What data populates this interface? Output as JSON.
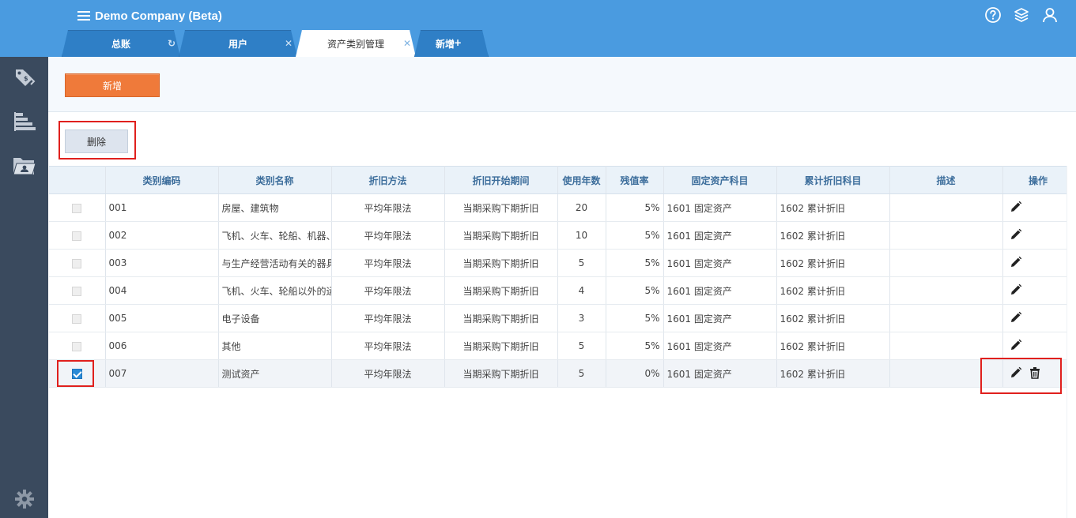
{
  "app": {
    "title": "Demo Company (Beta)"
  },
  "header_icons": [
    "help-icon",
    "layers-icon",
    "user-icon"
  ],
  "tabs": [
    {
      "label": "总账",
      "icon": "refresh-icon",
      "active": false
    },
    {
      "label": "用户",
      "icon": "close-icon",
      "active": false
    },
    {
      "label": "资产类别管理",
      "icon": "close-icon",
      "active": true
    },
    {
      "label": "新增",
      "icon": "plus-icon",
      "active": false
    }
  ],
  "sidebar": {
    "items": [
      "tags-icon",
      "bar-chart-icon",
      "folder-icon",
      "gear-icon"
    ]
  },
  "toolbar": {
    "add_label": "新增",
    "delete_label": "删除"
  },
  "table": {
    "columns": [
      "类别编码",
      "类别名称",
      "折旧方法",
      "折旧开始期间",
      "使用年数",
      "残值率",
      "固定资产科目",
      "累计折旧科目",
      "描述",
      "操作"
    ],
    "rows": [
      {
        "checked": false,
        "code": "001",
        "name": "房屋、建筑物",
        "method": "平均年限法",
        "start": "当期采购下期折旧",
        "years": "20",
        "residual": "5%",
        "asset_account": "1601 固定资产",
        "dep_account": "1602 累计折旧",
        "desc": "",
        "can_delete": false
      },
      {
        "checked": false,
        "code": "002",
        "name": "飞机、火车、轮船、机器、",
        "method": "平均年限法",
        "start": "当期采购下期折旧",
        "years": "10",
        "residual": "5%",
        "asset_account": "1601 固定资产",
        "dep_account": "1602 累计折旧",
        "desc": "",
        "can_delete": false
      },
      {
        "checked": false,
        "code": "003",
        "name": "与生产经营活动有关的器具",
        "method": "平均年限法",
        "start": "当期采购下期折旧",
        "years": "5",
        "residual": "5%",
        "asset_account": "1601 固定资产",
        "dep_account": "1602 累计折旧",
        "desc": "",
        "can_delete": false
      },
      {
        "checked": false,
        "code": "004",
        "name": "飞机、火车、轮船以外的运",
        "method": "平均年限法",
        "start": "当期采购下期折旧",
        "years": "4",
        "residual": "5%",
        "asset_account": "1601 固定资产",
        "dep_account": "1602 累计折旧",
        "desc": "",
        "can_delete": false
      },
      {
        "checked": false,
        "code": "005",
        "name": "电子设备",
        "method": "平均年限法",
        "start": "当期采购下期折旧",
        "years": "3",
        "residual": "5%",
        "asset_account": "1601 固定资产",
        "dep_account": "1602 累计折旧",
        "desc": "",
        "can_delete": false
      },
      {
        "checked": false,
        "code": "006",
        "name": "其他",
        "method": "平均年限法",
        "start": "当期采购下期折旧",
        "years": "5",
        "residual": "5%",
        "asset_account": "1601 固定资产",
        "dep_account": "1602 累计折旧",
        "desc": "",
        "can_delete": false
      },
      {
        "checked": true,
        "code": "007",
        "name": "测试资产",
        "method": "平均年限法",
        "start": "当期采购下期折旧",
        "years": "5",
        "residual": "0%",
        "asset_account": "1601 固定资产",
        "dep_account": "1602 累计折旧",
        "desc": "",
        "can_delete": true
      }
    ]
  },
  "colors": {
    "header_bg": "#4a9be0",
    "sidebar_bg": "#3a4a5e",
    "add_button": "#ef7a3a",
    "highlight": "#e0201d",
    "checkbox": "#2a8ad6"
  }
}
